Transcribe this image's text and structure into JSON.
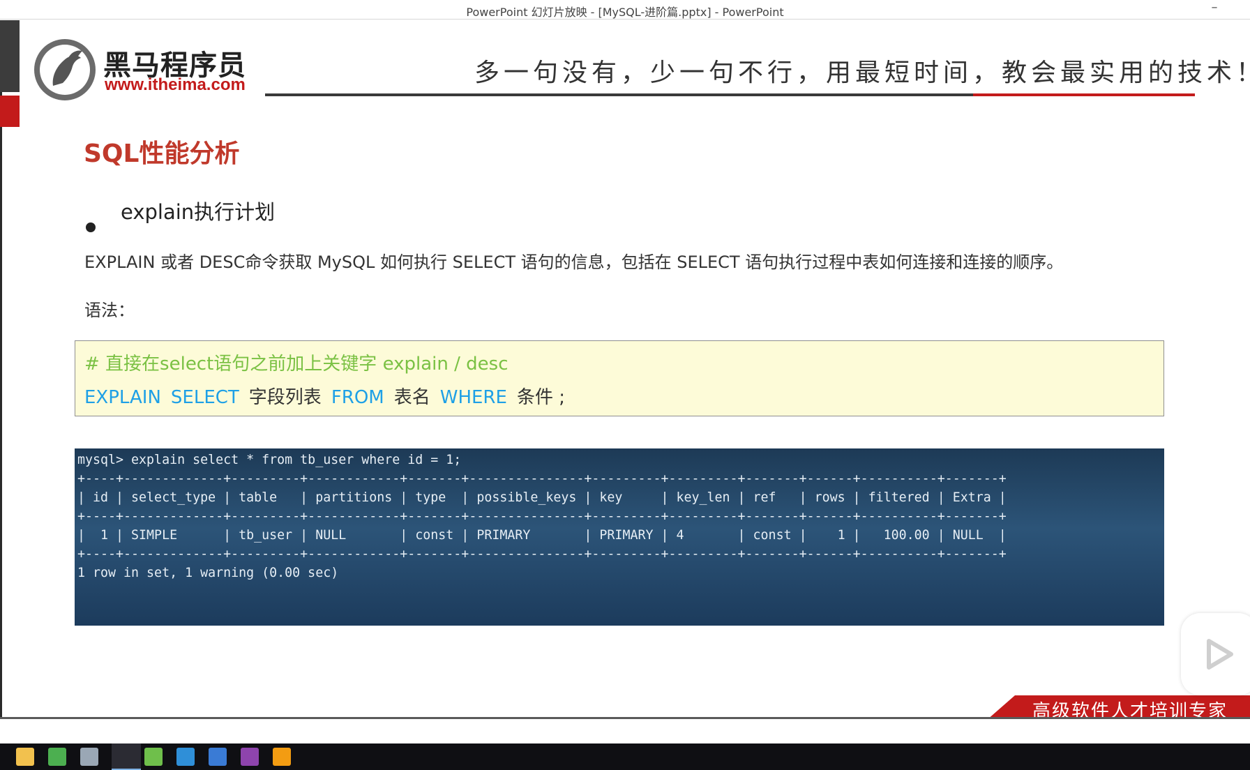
{
  "window": {
    "title": "PowerPoint 幻灯片放映 - [MySQL-进阶篇.pptx] - PowerPoint",
    "minimize_glyph": "–"
  },
  "slide": {
    "logo": {
      "name_cn": "黑马程序员",
      "url": "www.itheima.com"
    },
    "motto": "多一句没有，少一句不行，用最短时间，教会最实用的技术！",
    "heading": "SQL性能分析",
    "bullet": "explain执行计划",
    "description": "EXPLAIN 或者 DESC命令获取 MySQL 如何执行 SELECT 语句的信息，包括在 SELECT 语句执行过程中表如何连接和连接的顺序。",
    "syntax_label": "语法：",
    "code": {
      "comment": "# 直接在select语句之前加上关键字 explain / desc",
      "tokens": [
        {
          "text": "EXPLAIN",
          "kind": "keyword"
        },
        {
          "text": "SELECT",
          "kind": "keyword"
        },
        {
          "text": "字段列表",
          "kind": "plain"
        },
        {
          "text": "FROM",
          "kind": "keyword"
        },
        {
          "text": "表名",
          "kind": "plain"
        },
        {
          "text": "WHERE",
          "kind": "keyword"
        },
        {
          "text": "条件 ;",
          "kind": "plain"
        }
      ],
      "keyword_color": "#1ea0e6",
      "comment_color": "#7ac143"
    },
    "terminal": {
      "lines": [
        "mysql> explain select * from tb_user where id = 1;",
        "+----+-------------+---------+------------+-------+---------------+---------+---------+-------+------+----------+-------+",
        "| id | select_type | table   | partitions | type  | possible_keys | key     | key_len | ref   | rows | filtered | Extra |",
        "+----+-------------+---------+------------+-------+---------------+---------+---------+-------+------+----------+-------+",
        "|  1 | SIMPLE      | tb_user | NULL       | const | PRIMARY       | PRIMARY | 4       | const |    1 |   100.00 | NULL  |",
        "+----+-------------+---------+------------+-------+---------------+---------+---------+-------+------+----------+-------+",
        "1 row in set, 1 warning (0.00 sec)"
      ]
    },
    "footer_banner": "高级软件人才培训专家",
    "accent_red": "#c31b1b"
  },
  "taskbar": {
    "apps": [
      {
        "icon": "file-explorer-icon",
        "color": "#f2c14e"
      },
      {
        "icon": "chrome-icon",
        "color": "#4caf50"
      },
      {
        "icon": "bird-icon",
        "color": "#9aa7b5"
      },
      {
        "icon": "powerpoint-icon",
        "color": "#d24726"
      },
      {
        "icon": "notepad-icon",
        "color": "#6fbf4b"
      },
      {
        "icon": "box-app-icon",
        "color": "#2f8fd8"
      },
      {
        "icon": "remote-desktop-icon",
        "color": "#3a7bd5"
      },
      {
        "icon": "datagrip-icon",
        "color": "#8e44ad"
      },
      {
        "icon": "sublime-icon",
        "color": "#f39c12"
      }
    ]
  }
}
